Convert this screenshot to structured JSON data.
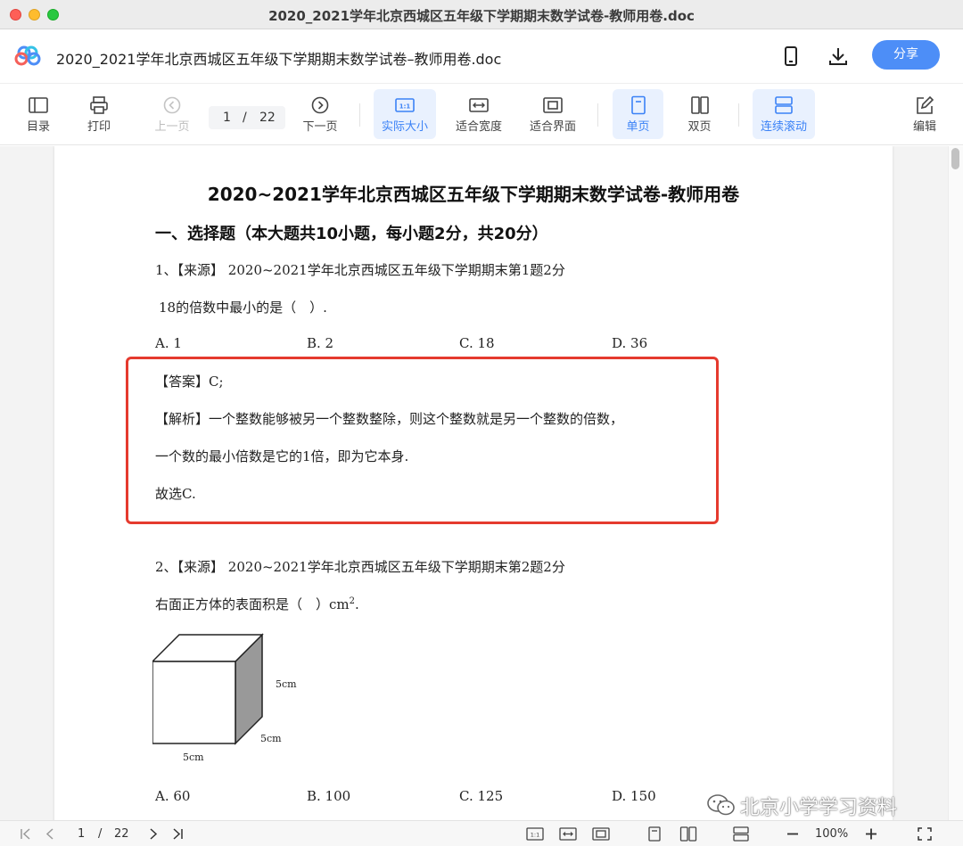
{
  "window": {
    "title": "2020_2021学年北京西城区五年级下学期期末数学试卷-教师用卷.doc"
  },
  "header": {
    "doc_name": "2020_2021学年北京西城区五年级下学期期末数学试卷–教师用卷.doc",
    "share_label": "分享",
    "accent_color": "#4d8ef7"
  },
  "toolbar": {
    "toc_label": "目录",
    "print_label": "打印",
    "prev_label": "上一页",
    "page_current": "1",
    "page_sep": "/",
    "page_total": "22",
    "next_label": "下一页",
    "actual_size_label": "实际大小",
    "fit_width_label": "适合宽度",
    "fit_screen_label": "适合界面",
    "single_page_label": "单页",
    "double_page_label": "双页",
    "continuous_label": "连续滚动",
    "edit_label": "编辑"
  },
  "document": {
    "title": "2020~2021学年北京西城区五年级下学期期末数学试卷-教师用卷",
    "section": "一、选择题（本大题共10小题，每小题2分，共20分）",
    "q1": {
      "source": "1、【来源】 2020~2021学年北京西城区五年级下学期期末第1题2分",
      "stem": "18的倍数中最小的是（　）.",
      "options": [
        "A. 1",
        "B. 2",
        "C. 18",
        "D. 36"
      ],
      "answer": "【答案】C;",
      "analysis_1": "【解析】一个整数能够被另一个整数整除，则这个整数就是另一个整数的倍数，",
      "analysis_2": "一个数的最小倍数是它的1倍，即为它本身.",
      "conclusion": "故选C."
    },
    "q2": {
      "source": "2、【来源】 2020~2021学年北京西城区五年级下学期期末第2题2分",
      "stem_prefix": "右面正方体的表面积是（　）",
      "stem_unit": "cm",
      "stem_sup": "2",
      "stem_end": ".",
      "cube_labels": [
        "5cm",
        "5cm",
        "5cm"
      ],
      "options": [
        "A. 60",
        "B. 100",
        "C. 125",
        "D. 150"
      ]
    }
  },
  "watermark": {
    "text": "北京小学学习资料"
  },
  "statusbar": {
    "page_current": "1",
    "page_sep": "/",
    "page_total": "22",
    "zoom": "100%"
  }
}
